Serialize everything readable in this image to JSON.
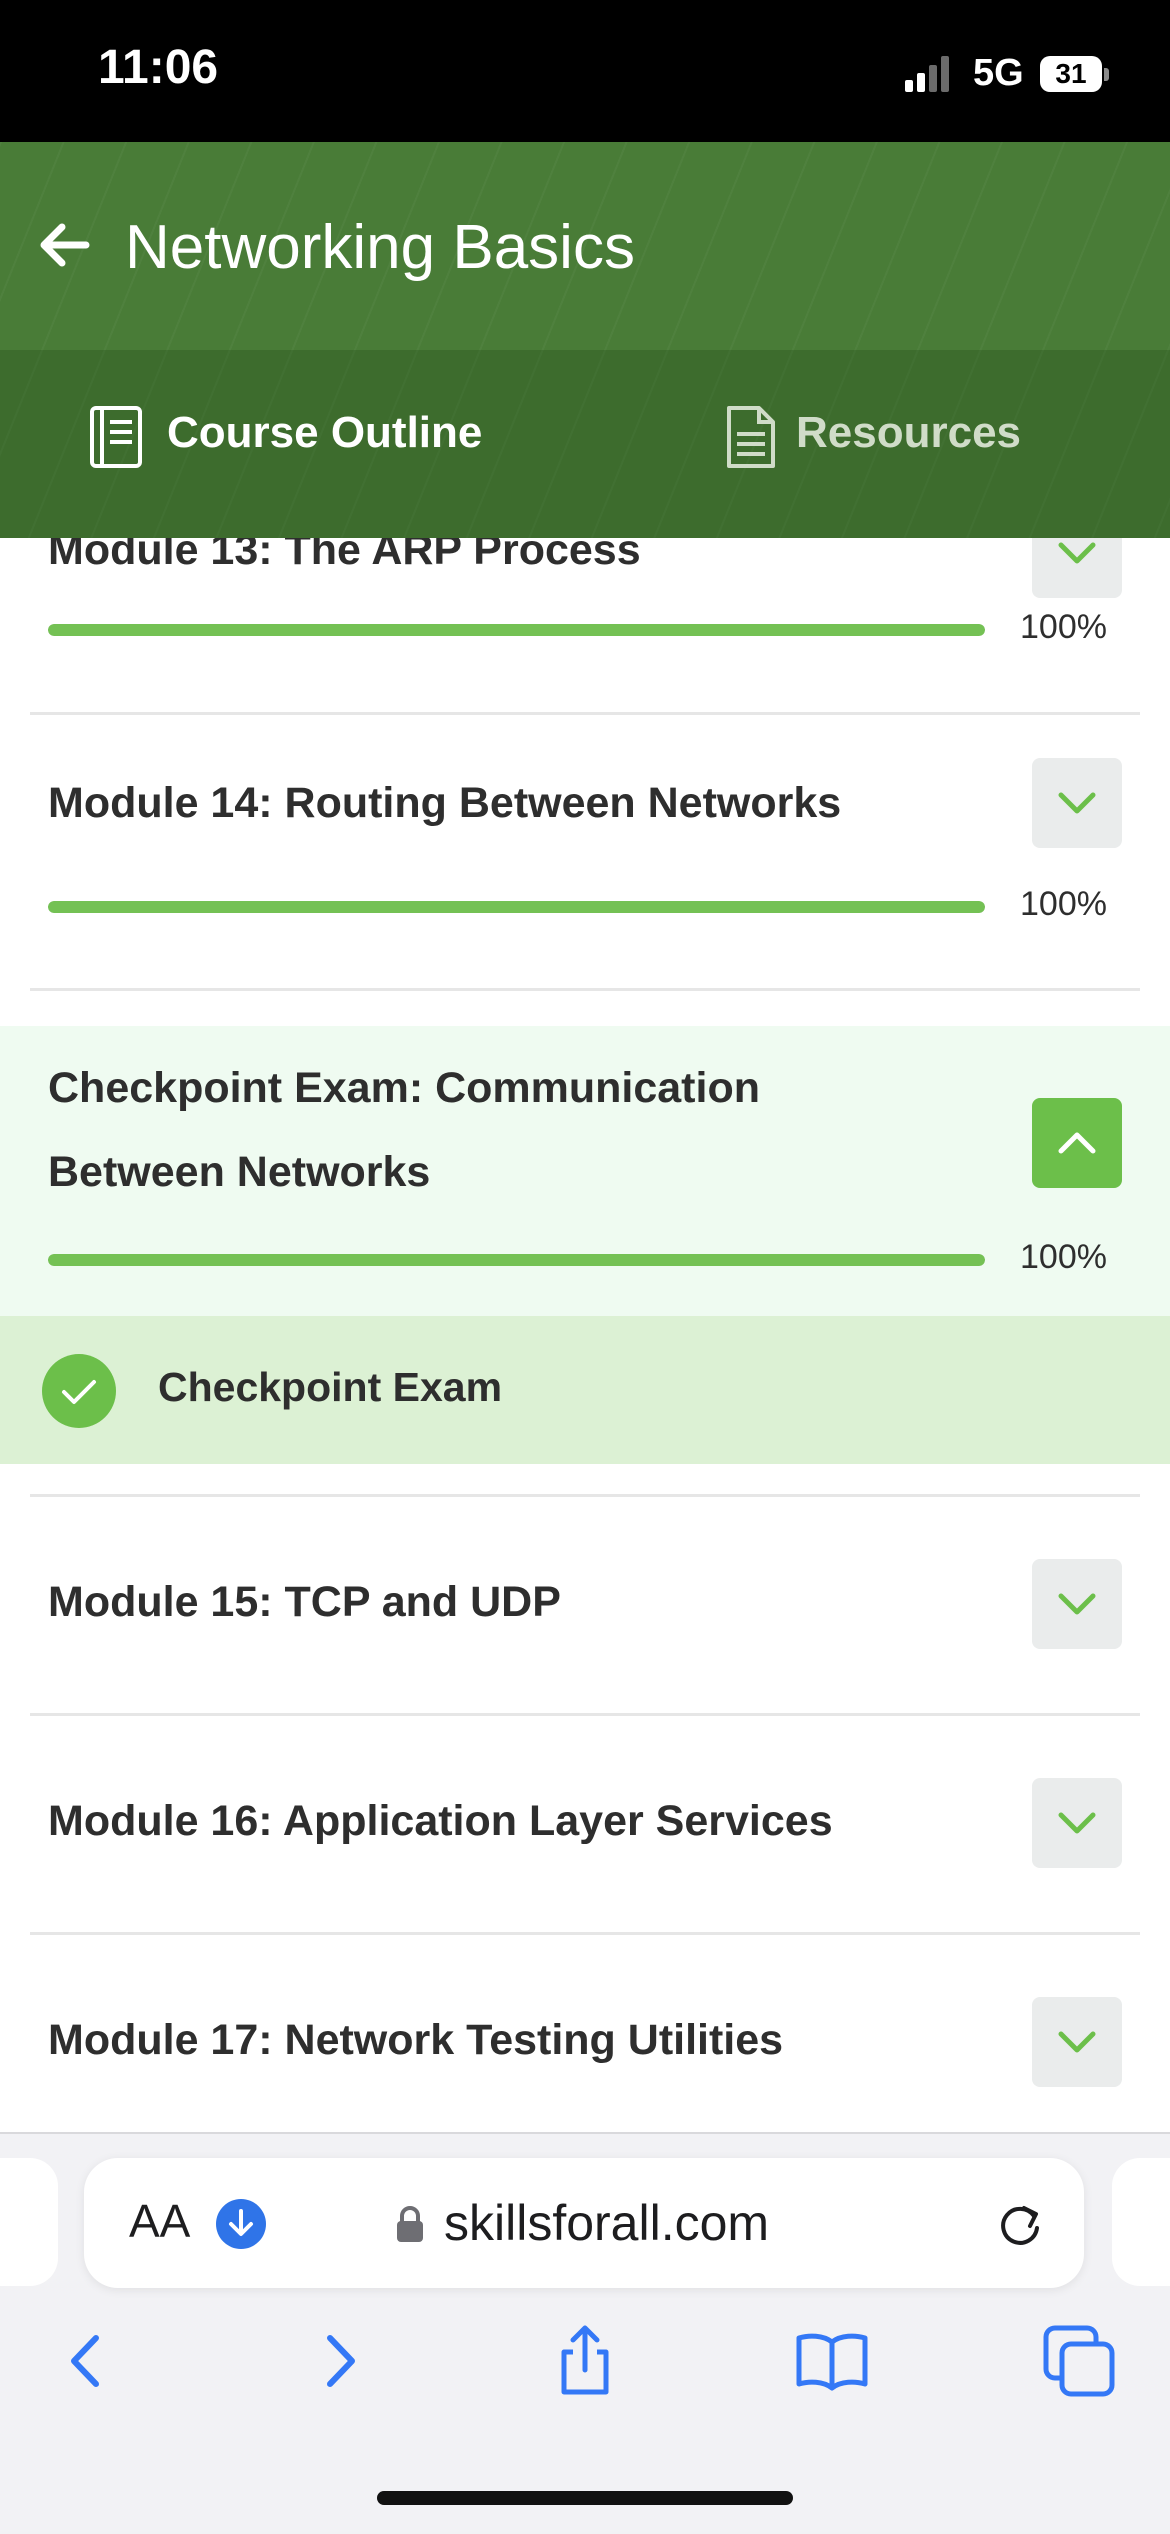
{
  "status_bar": {
    "time": "11:06",
    "network": "5G",
    "battery": "31"
  },
  "header": {
    "title": "Networking Basics",
    "tabs": [
      {
        "label": "Course Outline",
        "active": true
      },
      {
        "label": "Resources",
        "active": false
      }
    ]
  },
  "modules": [
    {
      "title": "Module 13: The ARP Process",
      "progress_label": "100%",
      "progress": 1.0,
      "expanded": false
    },
    {
      "title": "Module 14: Routing Between Networks",
      "progress_label": "100%",
      "progress": 1.0,
      "expanded": false
    },
    {
      "title_line1": "Checkpoint Exam: Communication",
      "title_line2": "Between Networks",
      "progress_label": "100%",
      "progress": 1.0,
      "expanded": true,
      "items": [
        {
          "label": "Checkpoint Exam",
          "completed": true
        }
      ]
    },
    {
      "title": "Module 15: TCP and UDP",
      "expanded": false
    },
    {
      "title": "Module 16: Application Layer Services",
      "expanded": false
    },
    {
      "title": "Module 17: Network Testing Utilities",
      "expanded": false
    }
  ],
  "browser": {
    "text_size": "AA",
    "url": "skillsforall.com"
  },
  "colors": {
    "header": "#497c37",
    "accent": "#6cbf4a",
    "progress": "#74c154",
    "expanded_bg": "#effbf1",
    "exam_row_bg": "#dcf1d4"
  }
}
